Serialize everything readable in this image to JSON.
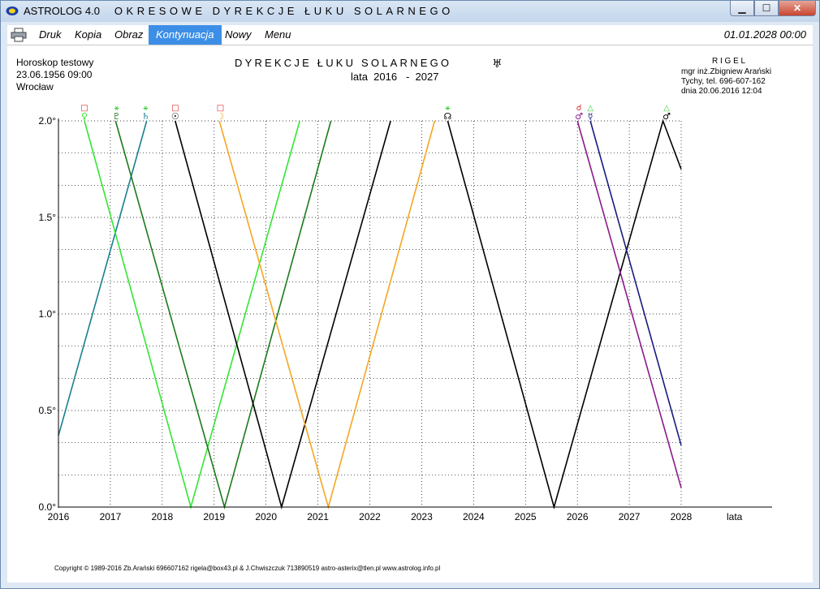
{
  "window": {
    "app_name": "ASTROLOG 4.0",
    "subtitle": "OKRESOWE DYREKCJE ŁUKU SOLARNEGO"
  },
  "menu": {
    "items": [
      "Druk",
      "Kopia",
      "Obraz",
      "Kontynuacja",
      "Nowy",
      "Menu"
    ],
    "active": "Kontynuacja",
    "datetime": "01.01.2028  00:00"
  },
  "horoscope": {
    "name": "Horoskop testowy",
    "date": "23.06.1956  09:00",
    "place": "Wrocław"
  },
  "author": {
    "company": "R I G E L",
    "name": "mgr inż.Zbigniew Arański",
    "phone": "Tychy, tel. 696-607-162",
    "date": "dnia 20.06.2016  12:04"
  },
  "footer": {
    "copyright": "Copyright © 1989-2016 Zb.Arański 696607162 rigela@box43.pl & J.Chwiszczuk 713890519 astro-asterix@tlen.pl www.astrolog.info.pl"
  },
  "colors": {
    "light_green": "#33e633",
    "dark_green": "#1c7a1c",
    "teal": "#1a7f8f",
    "black": "#000000",
    "orange": "#f5a623",
    "purple": "#8b1a8b",
    "navy": "#1a1a80",
    "red": "#e02020",
    "menu_active": "#3d8ee6"
  },
  "chart_data": {
    "type": "line",
    "title": "DYREKCJE ŁUKU SOLARNEGO",
    "title_symbol": "♅",
    "subtitle": "lata  2016   -  2027",
    "xlabel": "lata",
    "ylabel": "",
    "xlim": [
      2016,
      2028
    ],
    "ylim": [
      0,
      2.0
    ],
    "x_ticks": [
      "2016",
      "2017",
      "2018",
      "2019",
      "2020",
      "2021",
      "2022",
      "2023",
      "2024",
      "2025",
      "2026",
      "2027",
      "2028"
    ],
    "y_ticks": [
      "0.0°",
      "0.5°",
      "1.0°",
      "1.5°",
      "2.0°"
    ],
    "grid": true,
    "series": [
      {
        "color": "#1a7f8f",
        "points": [
          [
            2016.0,
            0.37
          ],
          [
            2017.7,
            2.0
          ]
        ]
      },
      {
        "color": "#33e633",
        "points": [
          [
            2016.5,
            2.0
          ],
          [
            2018.55,
            0.0
          ],
          [
            2020.65,
            2.0
          ]
        ]
      },
      {
        "color": "#1c7a1c",
        "points": [
          [
            2017.1,
            2.0
          ],
          [
            2019.2,
            0.0
          ],
          [
            2021.25,
            2.0
          ]
        ]
      },
      {
        "color": "#000000",
        "points": [
          [
            2018.25,
            2.0
          ],
          [
            2020.3,
            0.0
          ],
          [
            2022.4,
            2.0
          ]
        ]
      },
      {
        "color": "#f5a623",
        "points": [
          [
            2019.1,
            2.0
          ],
          [
            2021.2,
            0.0
          ],
          [
            2023.25,
            2.0
          ]
        ]
      },
      {
        "color": "#000000",
        "points": [
          [
            2023.5,
            2.0
          ],
          [
            2025.55,
            0.0
          ],
          [
            2027.65,
            2.0
          ],
          [
            2028.0,
            1.75
          ]
        ]
      },
      {
        "color": "#8b1a8b",
        "points": [
          [
            2026.0,
            2.0
          ],
          [
            2028.0,
            0.1
          ]
        ]
      },
      {
        "color": "#1a1a80",
        "points": [
          [
            2026.25,
            2.0
          ],
          [
            2028.0,
            0.32
          ]
        ]
      }
    ],
    "markers": [
      {
        "x": 2016.5,
        "aspect": "□",
        "aspect_color": "#e02020",
        "planet": "♀",
        "planet_color": "#33e633"
      },
      {
        "x": 2017.12,
        "aspect": "⚹",
        "aspect_color": "#33cc33",
        "planet": "♇",
        "planet_color": "#1c7a1c"
      },
      {
        "x": 2017.68,
        "aspect": "⚹",
        "aspect_color": "#33cc33",
        "planet": "♄",
        "planet_color": "#1a7f8f"
      },
      {
        "x": 2018.25,
        "aspect": "□",
        "aspect_color": "#e02020",
        "planet": "☉",
        "planet_color": "#000000"
      },
      {
        "x": 2019.12,
        "aspect": "□",
        "aspect_color": "#e02020",
        "planet": "☽",
        "planet_color": "#f5a623"
      },
      {
        "x": 2023.5,
        "aspect": "⚹",
        "aspect_color": "#33cc33",
        "planet": "☊",
        "planet_color": "#000000"
      },
      {
        "x": 2026.03,
        "aspect": "☌",
        "aspect_color": "#e02020",
        "planet": "♂",
        "planet_color": "#8b1a8b"
      },
      {
        "x": 2026.25,
        "aspect": "△",
        "aspect_color": "#33cc33",
        "planet": "☿",
        "planet_color": "#1a1a80"
      },
      {
        "x": 2027.72,
        "aspect": "△",
        "aspect_color": "#33cc33",
        "planet": "♂",
        "planet_color": "#000000"
      }
    ]
  }
}
